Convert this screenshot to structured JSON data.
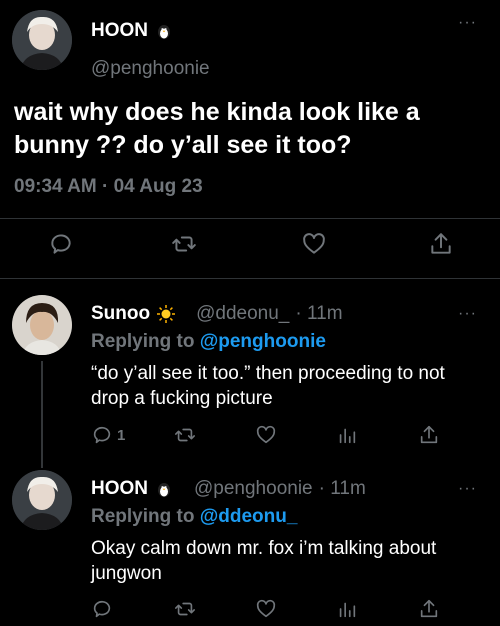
{
  "main_tweet": {
    "display_name": "HOON",
    "handle": "@penghoonie",
    "text": "wait why does he kinda look like a bunny ?? do y’all see it too?",
    "timestamp": "09:34 AM · 04 Aug 23",
    "more": "···",
    "badge_icon": "penguin-emoji"
  },
  "replies": [
    {
      "display_name": "Sunoo",
      "badge_icon": "sun-emoji",
      "handle": "@ddeonu_",
      "time": "· 11m",
      "replying_label": "Replying to",
      "replying_to": "@penghoonie",
      "text": "“do y’all see it too.” then proceeding to not drop a fucking picture",
      "reply_count": "1",
      "more": "···"
    },
    {
      "display_name": "HOON",
      "badge_icon": "penguin-emoji",
      "handle": "@penghoonie",
      "time": "· 11m",
      "replying_label": "Replying to",
      "replying_to": "@ddeonu_",
      "text": "Okay calm down mr. fox i’m talking about jungwon",
      "reply_count": "",
      "more": "···"
    }
  ],
  "colors": {
    "background": "#000000",
    "text": "#e7e9ea",
    "muted": "#71767b",
    "link": "#1d9bf0",
    "divider": "#2f3336"
  }
}
